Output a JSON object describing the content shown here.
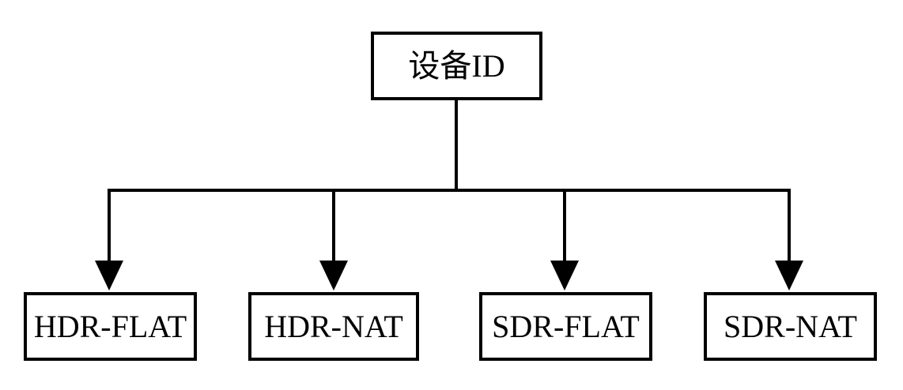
{
  "diagram": {
    "root": {
      "label": "设备ID"
    },
    "children": [
      {
        "label": "HDR-FLAT"
      },
      {
        "label": "HDR-NAT"
      },
      {
        "label": "SDR-FLAT"
      },
      {
        "label": "SDR-NAT"
      }
    ]
  },
  "colors": {
    "stroke": "#000000",
    "background": "#ffffff"
  }
}
